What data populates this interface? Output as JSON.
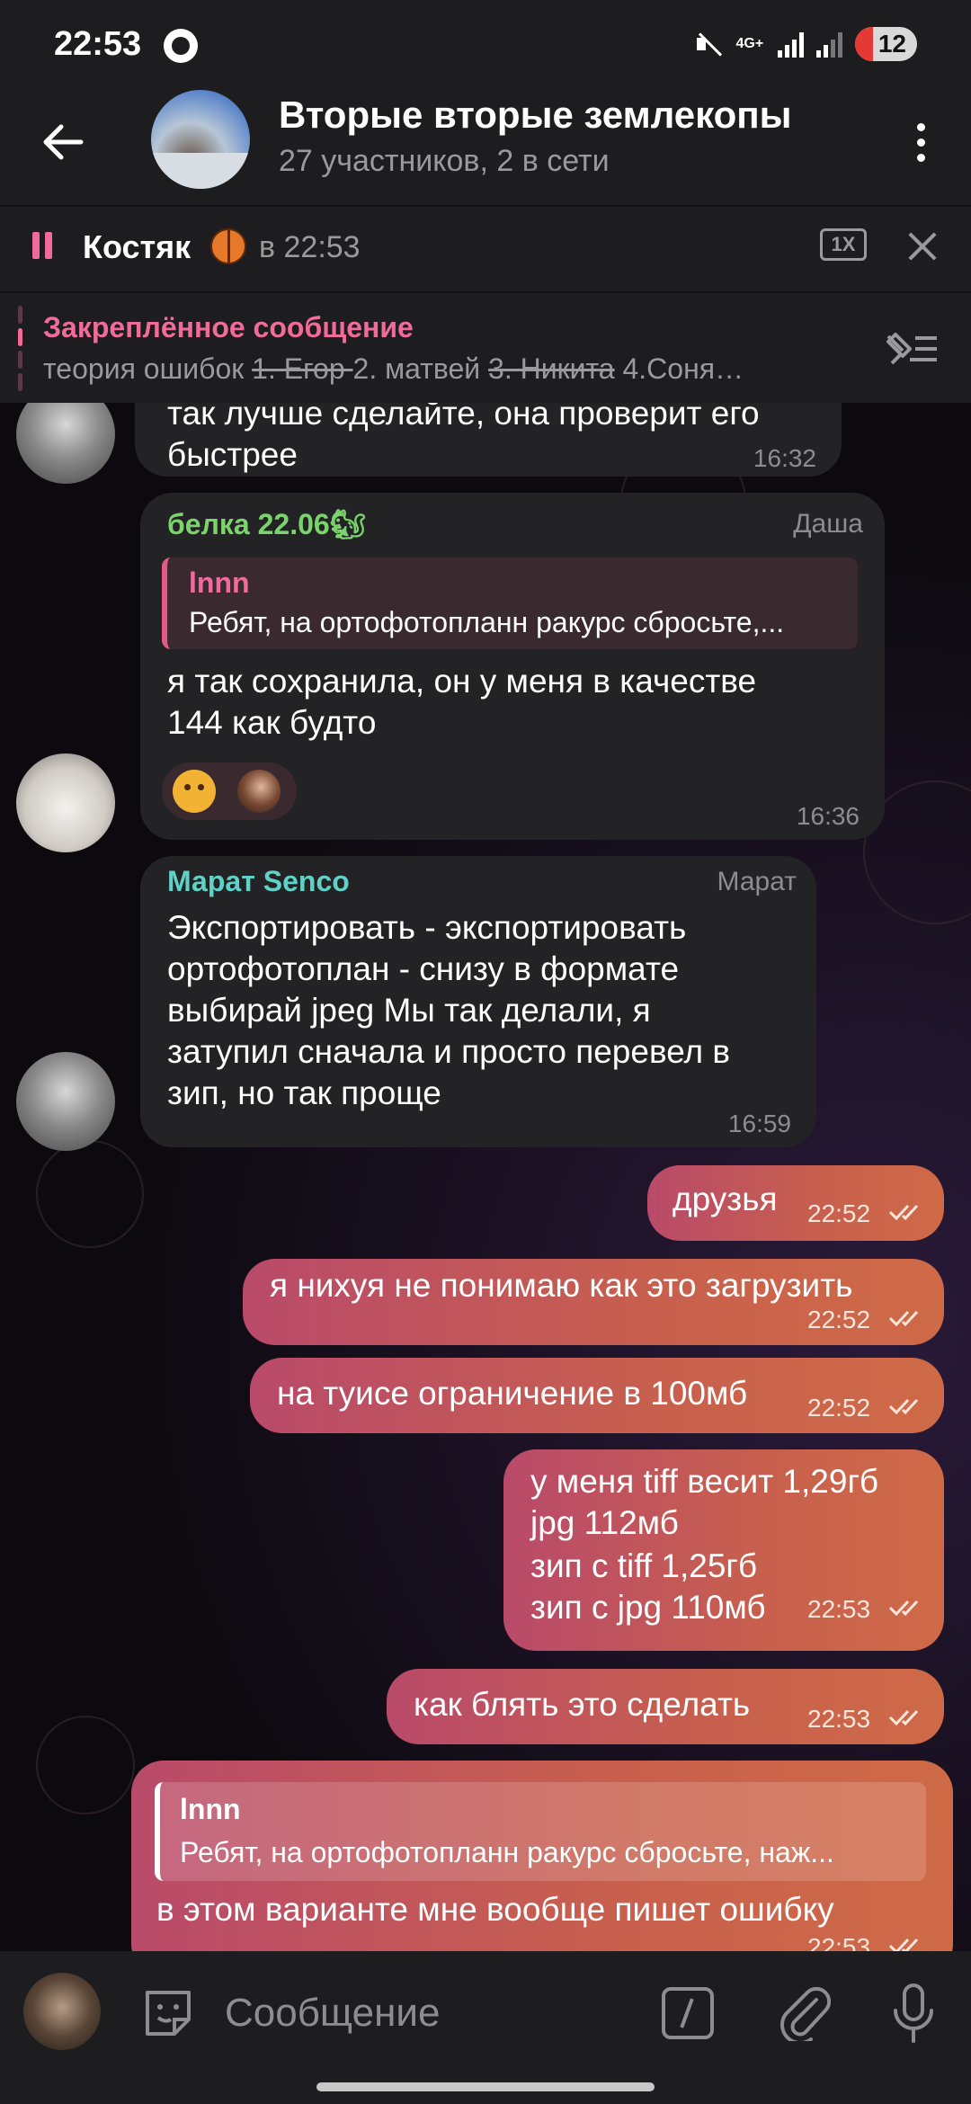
{
  "status_bar": {
    "time": "22:53",
    "network": "4G+",
    "battery": "12"
  },
  "header": {
    "title": "Вторые вторые землекопы",
    "subtitle": "27 участников, 2 в сети"
  },
  "player": {
    "name": "Костяк",
    "time": "в 22:53",
    "speed": "1X"
  },
  "pinned": {
    "title": "Закреплённое сообщение",
    "text_prefix": "теория ошибок ",
    "struck_1": "1. Егор ",
    "mid": "2. матвей ",
    "struck_2": "3. Никита",
    "suffix": " 4.Соня…"
  },
  "messages": {
    "m0": {
      "text_line1": "так лучше сделайте, она проверит его",
      "text_line2": "быстрее",
      "time": "16:32"
    },
    "m1": {
      "sender": "белка 22.06🐿",
      "role": "Даша",
      "quote_name": "lnnn",
      "quote_text": "Ребят, на ортофотопланн ракурс сбросьте,...",
      "text_line1": "я так сохранила, он у меня в качестве",
      "text_line2": "144 как будто",
      "reaction": "🤔",
      "time": "16:36"
    },
    "m2": {
      "sender": "Марат Senco",
      "role": "Марат",
      "lines": [
        "Экспортировать - экспортировать",
        "ортофотоплан - снизу в формате",
        "выбирай jpeg Мы так делали, я",
        "затупил сначала и просто перевел в",
        "зип, но так проще"
      ],
      "time": "16:59"
    },
    "o1": {
      "text": "друзья",
      "time": "22:52"
    },
    "o2": {
      "text": "я нихуя не понимаю как это загрузить",
      "time": "22:52"
    },
    "o3": {
      "text": "на туисе ограничение в 100мб",
      "time": "22:52"
    },
    "o4": {
      "lines": [
        "у меня tiff весит 1,29гб",
        "jpg 112мб",
        "зип с tiff 1,25гб",
        "зип с jpg 110мб"
      ],
      "time": "22:53"
    },
    "o5": {
      "text": "как блять это сделать",
      "time": "22:53"
    },
    "o6": {
      "quote_name": "lnnn",
      "quote_text": "Ребят, на ортофотопланн ракурс сбросьте, наж...",
      "text": "в этом варианте мне вообще пишет ошибку",
      "time": "22:53"
    }
  },
  "input": {
    "placeholder": "Сообщение"
  },
  "colors": {
    "accent_pink": "#f06b9c",
    "sender_green": "#7bd36b",
    "sender_teal": "#5fd1c6",
    "out_bubble_start": "#b94a6a",
    "out_bubble_end": "#cf6a47"
  }
}
